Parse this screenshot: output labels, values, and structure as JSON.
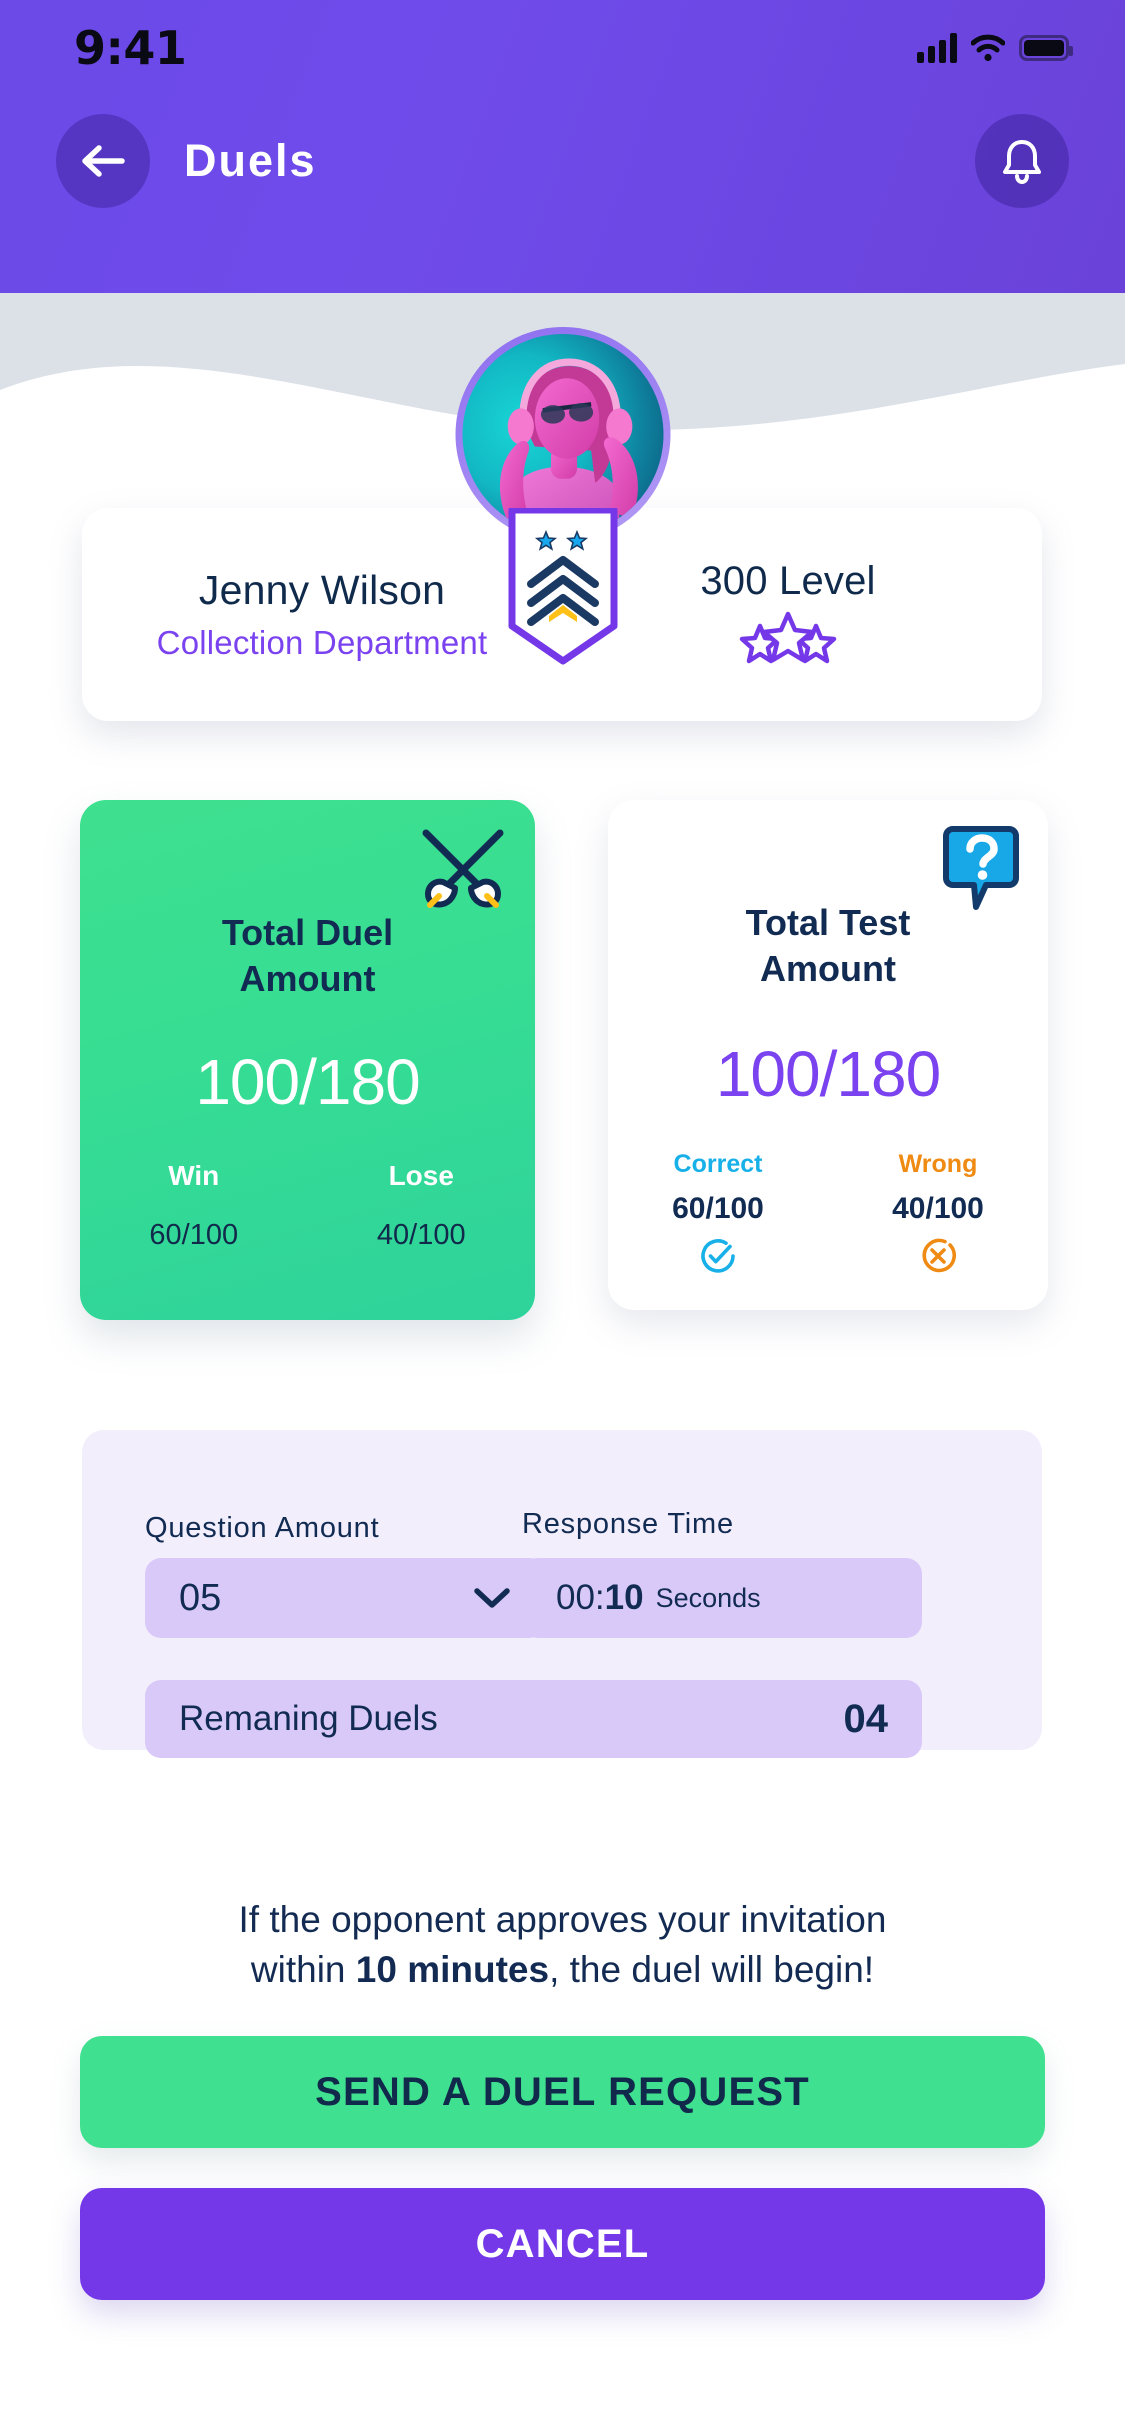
{
  "statusbar": {
    "time": "9:41",
    "icons": [
      "signal-icon",
      "wifi-icon",
      "battery-icon"
    ]
  },
  "header": {
    "title": "Duels",
    "back_icon": "arrow-left-icon",
    "notification_icon": "bell-icon",
    "background_color": "#6b4ae8"
  },
  "profile": {
    "name": "Jenny Wilson",
    "department": "Collection Department",
    "level": "300 Level",
    "avatar_icon": "user-avatar",
    "rank_badge_icon": "rank-chevron-badge",
    "stars_icon": "three-stars-icon",
    "dept_color": "#7b42f0"
  },
  "stats": {
    "duel": {
      "title": "Total Duel\nAmount",
      "title_line1": "Total Duel",
      "title_line2": "Amount",
      "value": "100/180",
      "icon": "crossed-swords-icon",
      "columns": [
        {
          "label": "Win",
          "value": "60/100"
        },
        {
          "label": "Lose",
          "value": "40/100"
        }
      ],
      "color": "#3fe08f"
    },
    "test": {
      "title_line1": "Total Test",
      "title_line2": "Amount",
      "value": "100/180",
      "icon": "question-bubble-icon",
      "columns": [
        {
          "label": "Correct",
          "value": "60/100",
          "icon": "check-circle-icon",
          "color": "#18b0e8"
        },
        {
          "label": "Wrong",
          "value": "40/100",
          "icon": "x-circle-icon",
          "color": "#ef8a13"
        }
      ],
      "value_color": "#7b42f0"
    }
  },
  "form": {
    "question_amount": {
      "label": "Question Amount",
      "value": "05",
      "dropdown_icon": "chevron-down-icon"
    },
    "response_time": {
      "label": "Response Time",
      "prefix": "00:",
      "value": "10",
      "unit": "Seconds"
    },
    "remaining_duels": {
      "label": "Remaning Duels",
      "value": "04"
    }
  },
  "note": {
    "line1": "If the opponent approves your invitation",
    "line2_before": "within ",
    "line2_bold": "10 minutes",
    "line2_after": ", the duel will begin!"
  },
  "actions": {
    "send": "SEND A DUEL REQUEST",
    "cancel": "CANCEL"
  }
}
